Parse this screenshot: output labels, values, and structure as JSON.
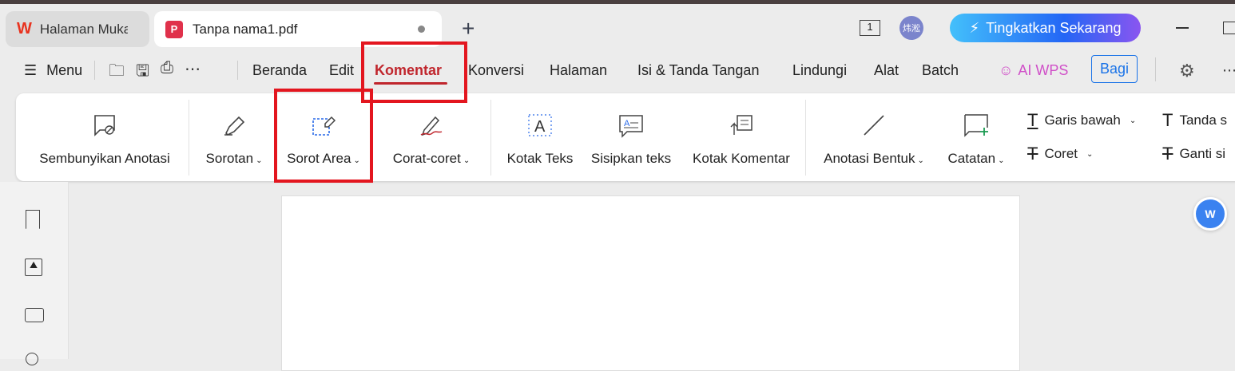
{
  "tabs": [
    {
      "label": "Halaman Muka"
    },
    {
      "label": "Tanpa nama1.pdf"
    }
  ],
  "new_tab": "+",
  "page_indicator": "1",
  "avatar_text": "炜淞",
  "upgrade_label": "Tingkatkan Sekarang",
  "menu_label": "Menu",
  "nav": [
    "Beranda",
    "Edit",
    "Komentar",
    "Konversi",
    "Halaman",
    "Isi & Tanda Tangan",
    "Lindungi",
    "Alat",
    "Batch"
  ],
  "ai_label": "AI WPS",
  "share_label": "Bagi",
  "tools": {
    "hide": "Sembunyikan Anotasi",
    "highlight": "Sorotan",
    "area": "Sorot Area",
    "draw": "Corat-coret",
    "textbox": "Kotak Teks",
    "insert": "Sisipkan teks",
    "commentbox": "Kotak Komentar",
    "shape": "Anotasi Bentuk",
    "note": "Catatan",
    "underline": "Garis bawah",
    "strike": "Coret",
    "insertmark": "Tanda s",
    "replace": "Ganti si"
  },
  "colors": {
    "accent": "#c0262d",
    "highlight_box": "#e3161f"
  }
}
